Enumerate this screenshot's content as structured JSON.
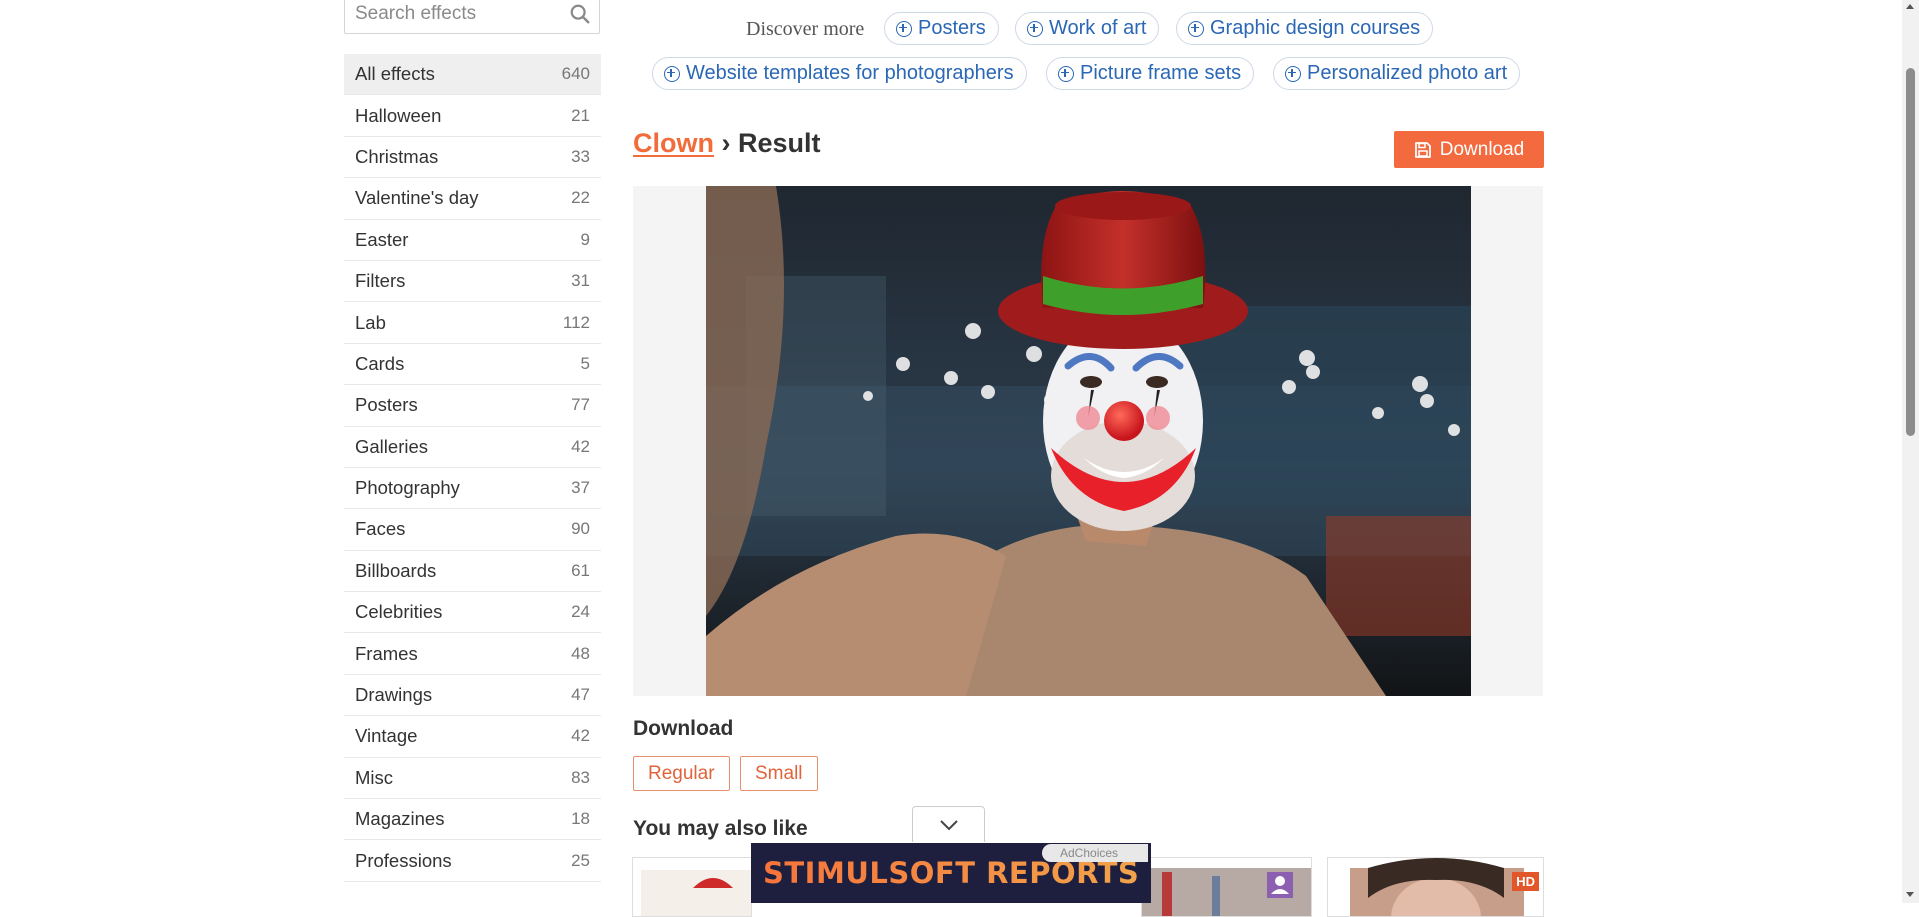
{
  "search": {
    "placeholder": "Search effects"
  },
  "sidebar": {
    "items": [
      {
        "label": "All effects",
        "count": "640"
      },
      {
        "label": "Halloween",
        "count": "21"
      },
      {
        "label": "Christmas",
        "count": "33"
      },
      {
        "label": "Valentine's day",
        "count": "22"
      },
      {
        "label": "Easter",
        "count": "9"
      },
      {
        "label": "Filters",
        "count": "31"
      },
      {
        "label": "Lab",
        "count": "112"
      },
      {
        "label": "Cards",
        "count": "5"
      },
      {
        "label": "Posters",
        "count": "77"
      },
      {
        "label": "Galleries",
        "count": "42"
      },
      {
        "label": "Photography",
        "count": "37"
      },
      {
        "label": "Faces",
        "count": "90"
      },
      {
        "label": "Billboards",
        "count": "61"
      },
      {
        "label": "Celebrities",
        "count": "24"
      },
      {
        "label": "Frames",
        "count": "48"
      },
      {
        "label": "Drawings",
        "count": "47"
      },
      {
        "label": "Vintage",
        "count": "42"
      },
      {
        "label": "Misc",
        "count": "83"
      },
      {
        "label": "Magazines",
        "count": "18"
      },
      {
        "label": "Professions",
        "count": "25"
      }
    ]
  },
  "discover": {
    "label": "Discover more",
    "chips": [
      "Posters",
      "Work of art",
      "Graphic design courses",
      "Website templates for photographers",
      "Picture frame sets",
      "Personalized photo art"
    ]
  },
  "heading": {
    "link": "Clown",
    "separator": " › ",
    "title": "Result"
  },
  "download_button": {
    "label": "Download"
  },
  "download_section": {
    "title": "Download",
    "regular": "Regular",
    "small": "Small"
  },
  "also_like": {
    "title": "You may also like",
    "hd_badge": "HD"
  },
  "ad": {
    "text": "STIMULSOFT REPORTS",
    "adchoices": "AdChoices"
  },
  "colors": {
    "accent": "#f36a3e",
    "link_blue": "#2a67b5"
  }
}
